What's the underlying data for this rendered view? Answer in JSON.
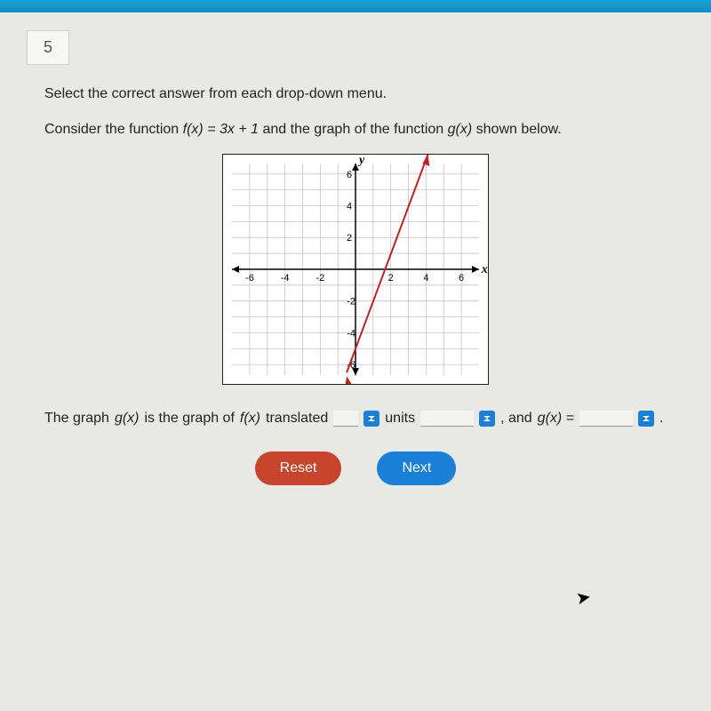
{
  "question_number": "5",
  "instruction": "Select the correct answer from each drop-down menu.",
  "prompt_prefix": "Consider the function ",
  "prompt_func": "f(x) = 3x + 1",
  "prompt_mid": " and the graph of the function ",
  "prompt_g": "g(x)",
  "prompt_suffix": " shown below.",
  "fill": {
    "prefix": "The graph ",
    "gx": "g(x)",
    "mid1": " is the graph of ",
    "fx": "f(x)",
    "mid2": " translated",
    "units_word": "units",
    "and_gx": ", and ",
    "gx_eq": "g(x) =",
    "period": "."
  },
  "buttons": {
    "reset": "Reset",
    "next": "Next"
  },
  "chart_data": {
    "type": "line",
    "title": "",
    "xlabel": "x",
    "ylabel": "y",
    "xlim": [
      -7,
      7
    ],
    "ylim": [
      -7,
      7
    ],
    "xticks": [
      -6,
      -4,
      -2,
      2,
      4,
      6
    ],
    "yticks": [
      -6,
      -4,
      -2,
      2,
      4,
      6
    ],
    "series": [
      {
        "name": "g(x)",
        "color": "#c02020",
        "points": [
          [
            0,
            -5
          ],
          [
            4,
            7
          ]
        ]
      }
    ],
    "grid": true
  }
}
